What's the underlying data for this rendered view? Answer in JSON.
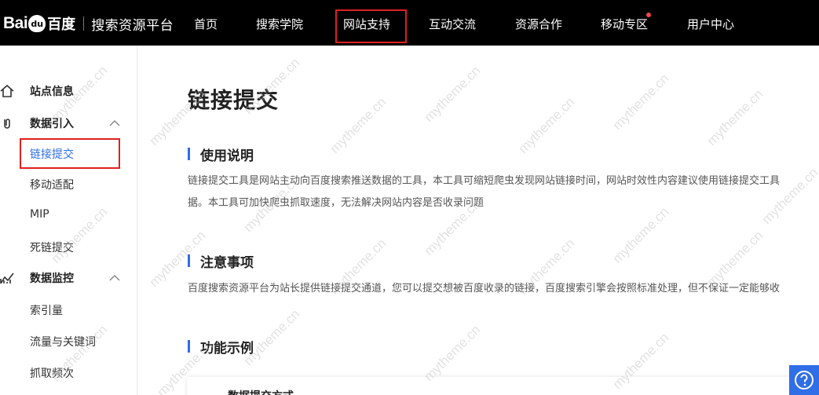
{
  "header": {
    "logo_text": "Bai",
    "logo_paw_text": "du",
    "logo_cn": "百度",
    "platform_name": "搜索资源平台",
    "nav": [
      {
        "label": "首页"
      },
      {
        "label": "搜索学院"
      },
      {
        "label": "网站支持",
        "active": true
      },
      {
        "label": "互动交流"
      },
      {
        "label": "资源合作"
      },
      {
        "label": "移动专区",
        "badge_dot": true
      },
      {
        "label": "用户中心"
      }
    ]
  },
  "sidebar": {
    "groups": [
      {
        "label": "站点信息",
        "icon": "home-icon"
      },
      {
        "label": "数据引入",
        "icon": "link-icon",
        "expanded": true,
        "items": [
          {
            "label": "链接提交",
            "active": true
          },
          {
            "label": "移动适配"
          },
          {
            "label": "MIP"
          },
          {
            "label": "死链提交"
          }
        ]
      },
      {
        "label": "数据监控",
        "icon": "chart-icon",
        "expanded": true,
        "items": [
          {
            "label": "索引量"
          },
          {
            "label": "流量与关键词"
          },
          {
            "label": "抓取频次"
          }
        ]
      }
    ]
  },
  "main": {
    "title": "链接提交",
    "sections": [
      {
        "title": "使用说明",
        "lines": [
          "链接提交工具是网站主动向百度搜索推送数据的工具，本工具可缩短爬虫发现网站链接时间，网站时效性内容建议使用链接提交工具",
          "据。本工具可加快爬虫抓取速度，无法解决网站内容是否收录问题"
        ]
      },
      {
        "title": "注意事项",
        "lines": [
          "百度搜索资源平台为站长提供链接提交通道，您可以提交想被百度收录的链接，百度搜索引擎会按照标准处理，但不保证一定能够收"
        ]
      },
      {
        "title": "功能示例",
        "lines": []
      }
    ],
    "card_title": "数据提交方式"
  },
  "watermark": "mytheme.cn",
  "colors": {
    "accent": "#2f6ee6",
    "highlight_box": "#e02020",
    "topbar": "#000000"
  }
}
